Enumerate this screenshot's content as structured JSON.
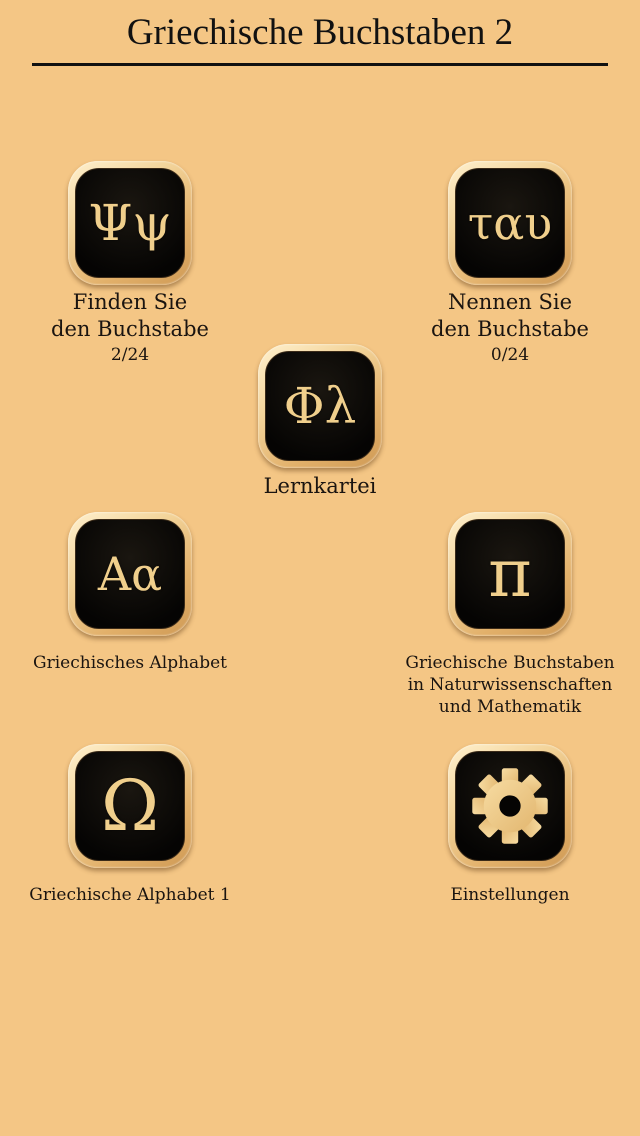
{
  "header": {
    "title": "Griechische Buchstaben 2"
  },
  "menu": {
    "find_letter": {
      "icon_text": "Ψψ",
      "icon_name": "psi-letters-icon",
      "label_lines": [
        "Finden Sie",
        "den Buchstabe"
      ],
      "progress": "2/24"
    },
    "name_letter": {
      "icon_text": "ταυ",
      "icon_name": "tau-word-icon",
      "label_lines": [
        "Nennen Sie",
        "den Buchstabe"
      ],
      "progress": "0/24"
    },
    "flashcards": {
      "icon_text": "Φλ",
      "icon_name": "phi-lambda-icon",
      "label": "Lernkartei"
    },
    "alphabet": {
      "icon_text": "Αα",
      "icon_name": "alpha-letters-icon",
      "label": "Griechisches Alphabet"
    },
    "science": {
      "icon_text": "π",
      "icon_name": "pi-icon",
      "label_lines": [
        "Griechische Buchstaben",
        "in Naturwissenschaften",
        "und Mathematik"
      ]
    },
    "alphabet1": {
      "icon_text": "Ω",
      "icon_name": "omega-icon",
      "label": "Griechische Alphabet 1"
    },
    "settings": {
      "icon_name": "gear-icon",
      "label": "Einstellungen"
    }
  },
  "colors": {
    "background": "#f4c685",
    "tile_dark": "#050403",
    "glyph_gold": "#f0cf8c"
  }
}
